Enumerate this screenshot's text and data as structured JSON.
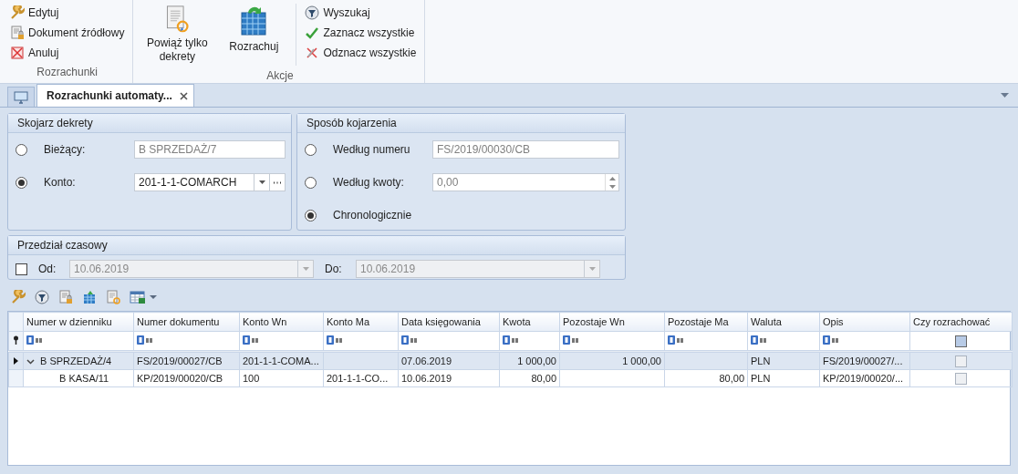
{
  "ribbon": {
    "groups": [
      {
        "label": "Rozrachunki",
        "items": [
          {
            "label": "Edytuj",
            "kind": "small"
          },
          {
            "label": "Dokument źródłowy",
            "kind": "small"
          },
          {
            "label": "Anuluj",
            "kind": "small"
          }
        ]
      },
      {
        "label": "Akcje",
        "items": [
          {
            "label": "Powiąż tylko dekrety",
            "kind": "large"
          },
          {
            "label": "Rozrachuj",
            "kind": "large"
          },
          {
            "label": "Wyszukaj",
            "kind": "small"
          },
          {
            "label": "Zaznacz wszystkie",
            "kind": "small"
          },
          {
            "label": "Odznacz wszystkie",
            "kind": "small"
          }
        ]
      }
    ]
  },
  "tabs": [
    {
      "label": "Rozrachunki automaty...",
      "selected": true
    }
  ],
  "match_entries": {
    "title": "Skojarz dekrety",
    "options": [
      {
        "label": "Bieżący:",
        "selected": false,
        "field": {
          "value": "B SPRZEDAŻ/7",
          "kind": "text",
          "disabled": true
        }
      },
      {
        "label": "Konto:",
        "selected": true,
        "field": {
          "value": "201-1-1-COMARCH",
          "kind": "combo",
          "disabled": false
        }
      }
    ]
  },
  "match_method": {
    "title": "Sposób kojarzenia",
    "options": [
      {
        "label": "Według numeru",
        "selected": false,
        "field": {
          "value": "FS/2019/00030/CB",
          "kind": "text",
          "disabled": true
        }
      },
      {
        "label": "Według kwoty:",
        "selected": false,
        "field": {
          "value": "0,00",
          "kind": "spin",
          "disabled": true
        }
      },
      {
        "label": "Chronologicznie",
        "selected": true
      }
    ]
  },
  "date_range": {
    "title": "Przedział czasowy",
    "checked": false,
    "from": {
      "label": "Od:",
      "value": "10.06.2019",
      "disabled": true
    },
    "to": {
      "label": "Do:",
      "value": "10.06.2019",
      "disabled": true
    }
  },
  "table": {
    "columns": [
      {
        "label": "Numer w dzienniku",
        "kind": "text"
      },
      {
        "label": "Numer dokumentu",
        "kind": "text"
      },
      {
        "label": "Konto Wn",
        "kind": "text"
      },
      {
        "label": "Konto Ma",
        "kind": "text"
      },
      {
        "label": "Data księgowania",
        "kind": "text"
      },
      {
        "label": "Kwota",
        "kind": "amount"
      },
      {
        "label": "Pozostaje Wn",
        "kind": "amount"
      },
      {
        "label": "Pozostaje Ma",
        "kind": "amount"
      },
      {
        "label": "Waluta",
        "kind": "text"
      },
      {
        "label": "Opis",
        "kind": "text"
      },
      {
        "label": "Czy rozrachować",
        "kind": "check",
        "filter_indeterminate": true
      }
    ],
    "rows": [
      {
        "selected": true,
        "expanded": true,
        "cells": [
          "B SPRZEDAŻ/4",
          "FS/2019/00027/CB",
          "201-1-1-COMA...",
          null,
          "07.06.2019",
          "1 000,00",
          "1 000,00",
          null,
          "PLN",
          "FS/2019/00027/...",
          false
        ],
        "children": [
          {
            "selected": false,
            "cells": [
              "B KASA/11",
              "KP/2019/00020/CB",
              "100",
              "201-1-1-CO...",
              "10.06.2019",
              "80,00",
              null,
              "80,00",
              "PLN",
              "KP/2019/00020/...",
              false
            ]
          }
        ]
      }
    ]
  }
}
